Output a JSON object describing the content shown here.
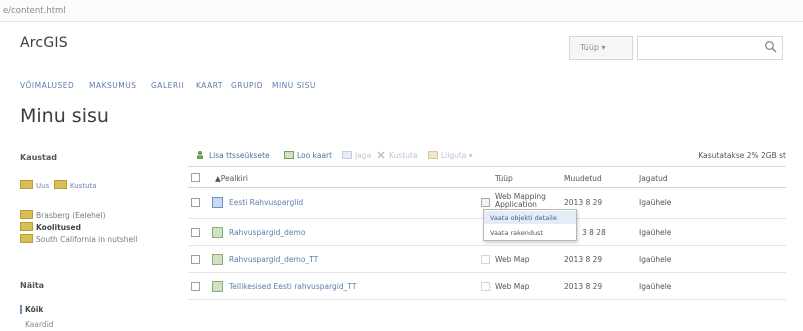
{
  "browser": {
    "url": "e/content.html"
  },
  "header": {
    "logo": "ArcGIS",
    "search_type": "Tüüp ▾",
    "search_placeholder": ""
  },
  "nav": {
    "items": [
      "VÕIMALUSED",
      "MAKSUMUS",
      "GALERII",
      "KAART",
      "GRUPID",
      "MINU SISU"
    ]
  },
  "page": {
    "title": "Minu sisu"
  },
  "sidebar": {
    "folders_heading": "Kaustad",
    "new_label": "Uus",
    "delete_label": "Kustuta",
    "folders": [
      "Brasberg (Eelehel)",
      "Koolitused",
      "South California in nutshell"
    ],
    "filter_heading": "Näita",
    "filters": [
      "Kõik",
      "Kaardid"
    ]
  },
  "toolbar": {
    "add_item": "Lisa ttsseüksete",
    "create_map": "Loo kaart",
    "share": "Jaga",
    "delete": "Kustuta",
    "move": "Liiguta ▾",
    "quota": "Kasutatakse 2% 2GB st"
  },
  "table": {
    "headers": [
      "▲Pealkiri",
      "Tüüp",
      "Muudetud",
      "Jagatud"
    ],
    "rows": [
      {
        "title": "Eesti Rahvusparglid",
        "type": "Web Mapping Application",
        "modified": "2013 8 29",
        "shared": "Igaühele",
        "icon": "app"
      },
      {
        "title": "Rahvuspargid_demo",
        "type": "",
        "modified": "3 8 28",
        "shared": "Igaühele",
        "icon": "map"
      },
      {
        "title": "Rahvuspargid_demo_TT",
        "type": "Web Map",
        "modified": "2013 8 29",
        "shared": "Igaühele",
        "icon": "map"
      },
      {
        "title": "Tellikesised Eesti rahvuspargid_TT",
        "type": "Web Map",
        "modified": "2013 8 29",
        "shared": "Igaühele",
        "icon": "map"
      }
    ]
  },
  "context_menu": {
    "items": [
      "Vaata objekti detaile",
      "Vaata rakendust"
    ]
  }
}
